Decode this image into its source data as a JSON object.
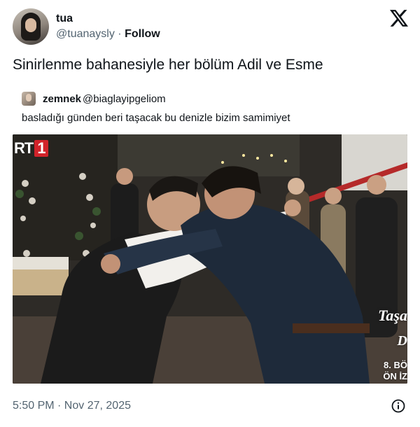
{
  "tweet": {
    "author_name": "tua",
    "author_handle": "@tuanaysly",
    "separator": "·",
    "follow_label": "Follow",
    "text": "Sinirlenme bahanesiyle her bölüm Adil ve Esme",
    "timestamp": "5:50 PM · Nov 27, 2025",
    "icons": {
      "brand": "x-logo-icon",
      "info": "info-icon"
    }
  },
  "quote": {
    "author_name": "zemnek",
    "author_handle": "@biaglayipgeliom",
    "text": "basladığı günden beri taşacak bu denizle bizim samimiyet"
  },
  "media": {
    "channel_logo_prefix": "RT",
    "channel_logo_number": "1",
    "overlay_title": "Taşa",
    "overlay_sub": "D",
    "overlay_episode": "8. BÖ",
    "overlay_preview": "ÖN İZ",
    "logo_red": "#d2232a"
  }
}
